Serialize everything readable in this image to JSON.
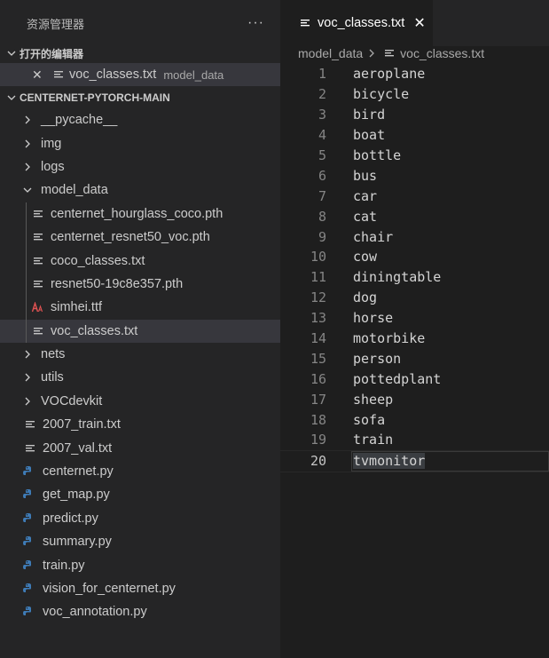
{
  "explorer": {
    "title": "资源管理器",
    "more_label": "···"
  },
  "open_editors": {
    "section_label": "打开的编辑器",
    "items": [
      {
        "name": "voc_classes.txt",
        "description": "model_data"
      }
    ]
  },
  "project": {
    "section_label": "CENTERNET-PYTORCH-MAIN",
    "tree": [
      {
        "label": "__pycache__",
        "kind": "folder",
        "expanded": false,
        "depth": 0
      },
      {
        "label": "img",
        "kind": "folder",
        "expanded": false,
        "depth": 0
      },
      {
        "label": "logs",
        "kind": "folder",
        "expanded": false,
        "depth": 0
      },
      {
        "label": "model_data",
        "kind": "folder",
        "expanded": true,
        "depth": 0
      },
      {
        "label": "centernet_hourglass_coco.pth",
        "kind": "file",
        "icon": "lines-icon",
        "depth": 1
      },
      {
        "label": "centernet_resnet50_voc.pth",
        "kind": "file",
        "icon": "lines-icon",
        "depth": 1
      },
      {
        "label": "coco_classes.txt",
        "kind": "file",
        "icon": "lines-icon",
        "depth": 1
      },
      {
        "label": "resnet50-19c8e357.pth",
        "kind": "file",
        "icon": "lines-icon",
        "depth": 1
      },
      {
        "label": "simhei.ttf",
        "kind": "file",
        "icon": "font-icon",
        "depth": 1
      },
      {
        "label": "voc_classes.txt",
        "kind": "file",
        "icon": "lines-icon",
        "depth": 1,
        "selected": true
      },
      {
        "label": "nets",
        "kind": "folder",
        "expanded": false,
        "depth": 0
      },
      {
        "label": "utils",
        "kind": "folder",
        "expanded": false,
        "depth": 0
      },
      {
        "label": "VOCdevkit",
        "kind": "folder",
        "expanded": false,
        "depth": 0
      },
      {
        "label": "2007_train.txt",
        "kind": "file",
        "icon": "lines-icon",
        "depth": 0
      },
      {
        "label": "2007_val.txt",
        "kind": "file",
        "icon": "lines-icon",
        "depth": 0
      },
      {
        "label": "centernet.py",
        "kind": "file",
        "icon": "python-icon",
        "depth": 0
      },
      {
        "label": "get_map.py",
        "kind": "file",
        "icon": "python-icon",
        "depth": 0
      },
      {
        "label": "predict.py",
        "kind": "file",
        "icon": "python-icon",
        "depth": 0
      },
      {
        "label": "summary.py",
        "kind": "file",
        "icon": "python-icon",
        "depth": 0
      },
      {
        "label": "train.py",
        "kind": "file",
        "icon": "python-icon",
        "depth": 0
      },
      {
        "label": "vision_for_centernet.py",
        "kind": "file",
        "icon": "python-icon",
        "depth": 0
      },
      {
        "label": "voc_annotation.py",
        "kind": "file",
        "icon": "python-icon",
        "depth": 0
      }
    ]
  },
  "editor": {
    "tab_label": "voc_classes.txt",
    "breadcrumb": [
      "model_data",
      "voc_classes.txt"
    ],
    "current_line": 20,
    "lines": [
      "aeroplane",
      "bicycle",
      "bird",
      "boat",
      "bottle",
      "bus",
      "car",
      "cat",
      "chair",
      "cow",
      "diningtable",
      "dog",
      "horse",
      "motorbike",
      "person",
      "pottedplant",
      "sheep",
      "sofa",
      "train",
      "tvmonitor"
    ]
  },
  "colors": {
    "python_blue": "#3e7bb6",
    "python_yellow": "#f7d04a",
    "font_red": "#e05252",
    "sidebar_bg": "#252526",
    "editor_bg": "#1e1e1e"
  }
}
